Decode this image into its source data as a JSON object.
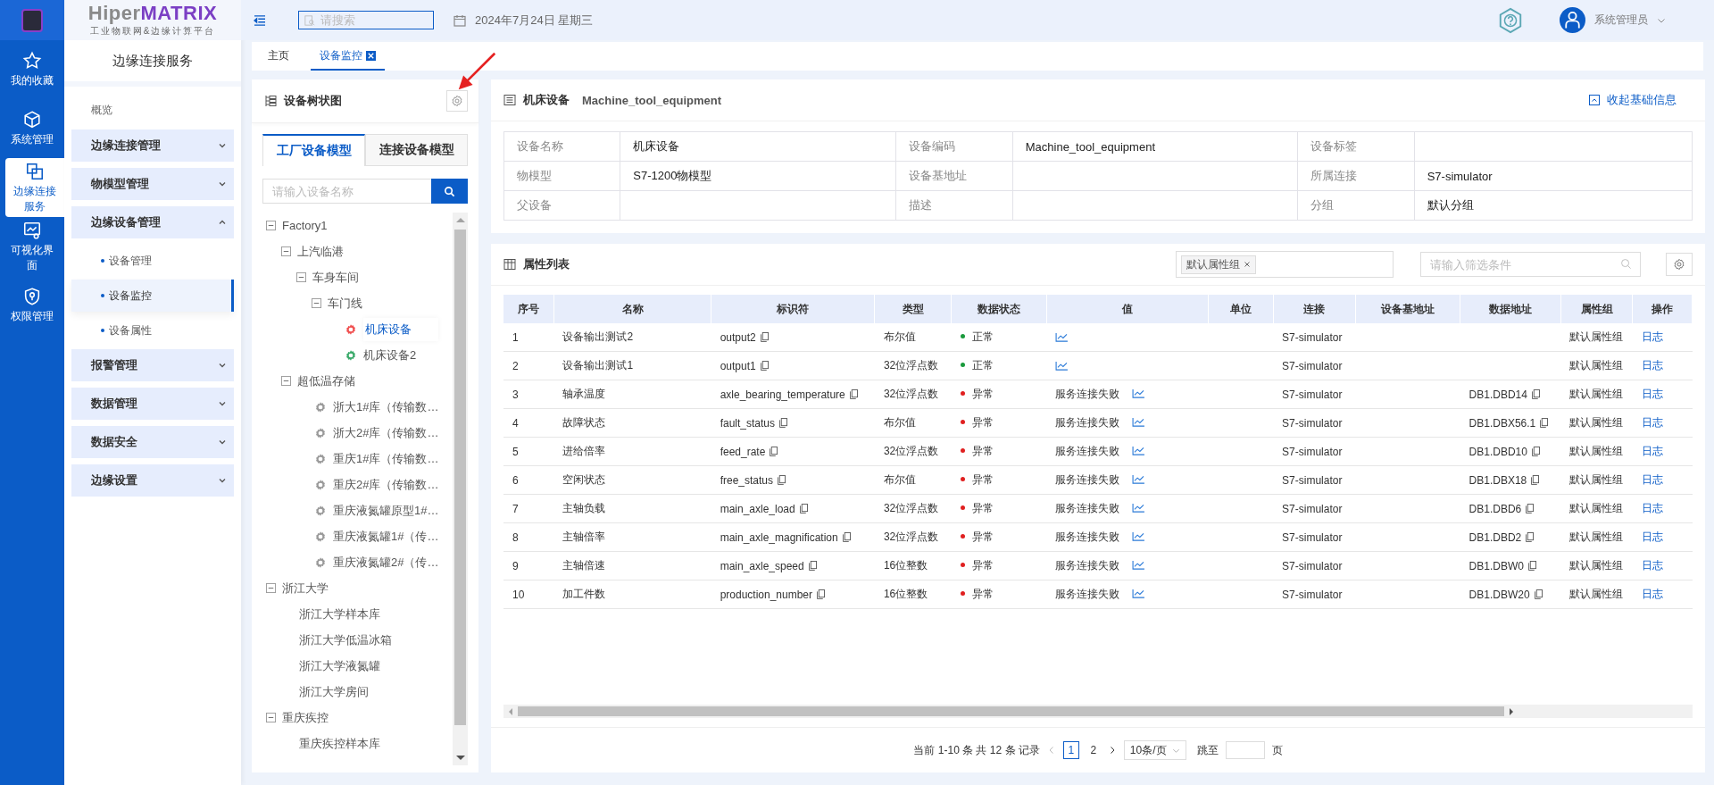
{
  "rail": [
    {
      "label": "我的收藏",
      "selected": false
    },
    {
      "label": "系统管理",
      "selected": false
    },
    {
      "label": "边缘连接服务",
      "selected": true
    },
    {
      "label": "可视化界面",
      "selected": false
    },
    {
      "label": "权限管理",
      "selected": false
    }
  ],
  "brand": {
    "parts": [
      "Hiper",
      "MATRIX"
    ],
    "subtitle": "工业物联网&边缘计算平台"
  },
  "sidebar": {
    "title": "边缘连接服务",
    "items": [
      {
        "kind": "link",
        "label": "概览"
      },
      {
        "kind": "group",
        "label": "边缘连接管理",
        "expanded": false
      },
      {
        "kind": "group",
        "label": "物模型管理",
        "expanded": false
      },
      {
        "kind": "group",
        "label": "边缘设备管理",
        "expanded": true,
        "children": [
          {
            "label": "设备管理",
            "selected": false
          },
          {
            "label": "设备监控",
            "selected": true
          },
          {
            "label": "设备属性",
            "selected": false
          }
        ]
      },
      {
        "kind": "group",
        "label": "报警管理",
        "expanded": false
      },
      {
        "kind": "group",
        "label": "数据管理",
        "expanded": false
      },
      {
        "kind": "group",
        "label": "数据安全",
        "expanded": false
      },
      {
        "kind": "group",
        "label": "边缘设置",
        "expanded": false
      }
    ]
  },
  "header": {
    "search_placeholder": "请搜索",
    "date": "2024年7月24日 星期三",
    "user": "系统管理员"
  },
  "tabs": [
    {
      "label": "主页",
      "selected": false,
      "closable": false
    },
    {
      "label": "设备监控",
      "selected": true,
      "closable": true
    }
  ],
  "tree_panel": {
    "title": "设备树状图",
    "tabs": [
      {
        "label": "工厂设备模型",
        "selected": true
      },
      {
        "label": "连接设备模型",
        "selected": false
      }
    ],
    "search_placeholder": "请输入设备名称",
    "nodes": [
      {
        "label": "Factory1",
        "expanded": true,
        "children": [
          {
            "label": "上汽临港",
            "expanded": true,
            "children": [
              {
                "label": "车身车间",
                "expanded": true,
                "children": [
                  {
                    "label": "车门线",
                    "expanded": true,
                    "children": [
                      {
                        "label": "机床设备",
                        "color": "#f05050",
                        "selected": true
                      },
                      {
                        "label": "机床设备2",
                        "color": "#3aaa6a",
                        "selected": false
                      }
                    ]
                  }
                ]
              }
            ]
          },
          {
            "label": "超低温存储",
            "expanded": true,
            "children": [
              {
                "label": "浙大1#库（传输数…",
                "color": "#9a9a9a",
                "selected": false
              },
              {
                "label": "浙大2#库（传输数…",
                "color": "#9a9a9a",
                "selected": false
              },
              {
                "label": "重庆1#库（传输数…",
                "color": "#9a9a9a",
                "selected": false
              },
              {
                "label": "重庆2#库（传输数…",
                "color": "#9a9a9a",
                "selected": false
              },
              {
                "label": "重庆液氮罐原型1#…",
                "color": "#9a9a9a",
                "selected": false
              },
              {
                "label": "重庆液氮罐1#（传…",
                "color": "#9a9a9a",
                "selected": false
              },
              {
                "label": "重庆液氮罐2#（传…",
                "color": "#9a9a9a",
                "selected": false
              }
            ]
          }
        ]
      },
      {
        "label": "浙江大学",
        "expanded": true,
        "children": [
          {
            "label": "浙江大学样本库",
            "selected": false
          },
          {
            "label": "浙江大学低温冰箱",
            "selected": false
          },
          {
            "label": "浙江大学液氮罐",
            "selected": false
          },
          {
            "label": "浙江大学房间",
            "selected": false
          }
        ]
      },
      {
        "label": "重庆疾控",
        "expanded": true,
        "children": [
          {
            "label": "重庆疾控样本库",
            "selected": false
          }
        ]
      }
    ]
  },
  "device": {
    "name": "机床设备",
    "code": "Machine_tool_equipment",
    "collapse_link": "收起基础信息",
    "fields": [
      [
        {
          "label": "设备名称",
          "value": "机床设备"
        },
        {
          "label": "设备编码",
          "value": "Machine_tool_equipment"
        },
        {
          "label": "设备标签"
        }
      ],
      [
        {
          "label": "物模型",
          "value": "S7-1200物模型"
        },
        {
          "label": "设备基地址"
        },
        {
          "label": "所属连接",
          "value": "S7-simulator"
        }
      ],
      [
        {
          "label": "父设备"
        },
        {
          "label": "描述"
        },
        {
          "label": "分组",
          "value": "默认分组"
        }
      ]
    ]
  },
  "properties": {
    "title": "属性列表",
    "group_tag": "默认属性组",
    "filter_placeholder": "请输入筛选条件",
    "columns": [
      "序号",
      "名称",
      "标识符",
      "类型",
      "数据状态",
      "值",
      "单位",
      "连接",
      "设备基地址",
      "数据地址",
      "属性组",
      "操作"
    ],
    "rows": [
      {
        "seq": "1",
        "name": "设备输出测试2",
        "identifier": "output2",
        "type": "布尔值",
        "status": "正常",
        "color": "#1a9a3c",
        "connection": "S7-simulator",
        "group": "默认属性组",
        "action": "日志"
      },
      {
        "seq": "2",
        "name": "设备输出测试1",
        "identifier": "output1",
        "type": "32位浮点数",
        "status": "正常",
        "color": "#1a9a3c",
        "connection": "S7-simulator",
        "group": "默认属性组",
        "action": "日志"
      },
      {
        "seq": "3",
        "name": "轴承温度",
        "identifier": "axle_bearing_temperature",
        "type": "32位浮点数",
        "status": "异常",
        "color": "#e02020",
        "value": "服务连接失败",
        "connection": "S7-simulator",
        "data_address": "DB1.DBD14",
        "group": "默认属性组",
        "action": "日志"
      },
      {
        "seq": "4",
        "name": "故障状态",
        "identifier": "fault_status",
        "type": "布尔值",
        "status": "异常",
        "color": "#e02020",
        "value": "服务连接失败",
        "connection": "S7-simulator",
        "data_address": "DB1.DBX56.1",
        "group": "默认属性组",
        "action": "日志"
      },
      {
        "seq": "5",
        "name": "进给倍率",
        "identifier": "feed_rate",
        "type": "32位浮点数",
        "status": "异常",
        "color": "#e02020",
        "value": "服务连接失败",
        "connection": "S7-simulator",
        "data_address": "DB1.DBD10",
        "group": "默认属性组",
        "action": "日志"
      },
      {
        "seq": "6",
        "name": "空闲状态",
        "identifier": "free_status",
        "type": "布尔值",
        "status": "异常",
        "color": "#e02020",
        "value": "服务连接失败",
        "connection": "S7-simulator",
        "data_address": "DB1.DBX18",
        "group": "默认属性组",
        "action": "日志"
      },
      {
        "seq": "7",
        "name": "主轴负载",
        "identifier": "main_axle_load",
        "type": "32位浮点数",
        "status": "异常",
        "color": "#e02020",
        "value": "服务连接失败",
        "connection": "S7-simulator",
        "data_address": "DB1.DBD6",
        "group": "默认属性组",
        "action": "日志"
      },
      {
        "seq": "8",
        "name": "主轴倍率",
        "identifier": "main_axle_magnification",
        "type": "32位浮点数",
        "status": "异常",
        "color": "#e02020",
        "value": "服务连接失败",
        "connection": "S7-simulator",
        "data_address": "DB1.DBD2",
        "group": "默认属性组",
        "action": "日志"
      },
      {
        "seq": "9",
        "name": "主轴倍速",
        "identifier": "main_axle_speed",
        "type": "16位整数",
        "status": "异常",
        "color": "#e02020",
        "value": "服务连接失败",
        "connection": "S7-simulator",
        "data_address": "DB1.DBW0",
        "group": "默认属性组",
        "action": "日志"
      },
      {
        "seq": "10",
        "name": "加工件数",
        "identifier": "production_number",
        "type": "16位整数",
        "status": "异常",
        "color": "#e02020",
        "value": "服务连接失败",
        "connection": "S7-simulator",
        "data_address": "DB1.DBW20",
        "group": "默认属性组",
        "action": "日志"
      }
    ]
  },
  "pagination": {
    "summary": "当前 1-10 条 共 12 条 记录",
    "pages": [
      {
        "label": "1",
        "selected": true
      },
      {
        "label": "2",
        "selected": false
      }
    ],
    "page_size": "10条/页",
    "jump_label": "跳至",
    "page_unit": "页"
  }
}
